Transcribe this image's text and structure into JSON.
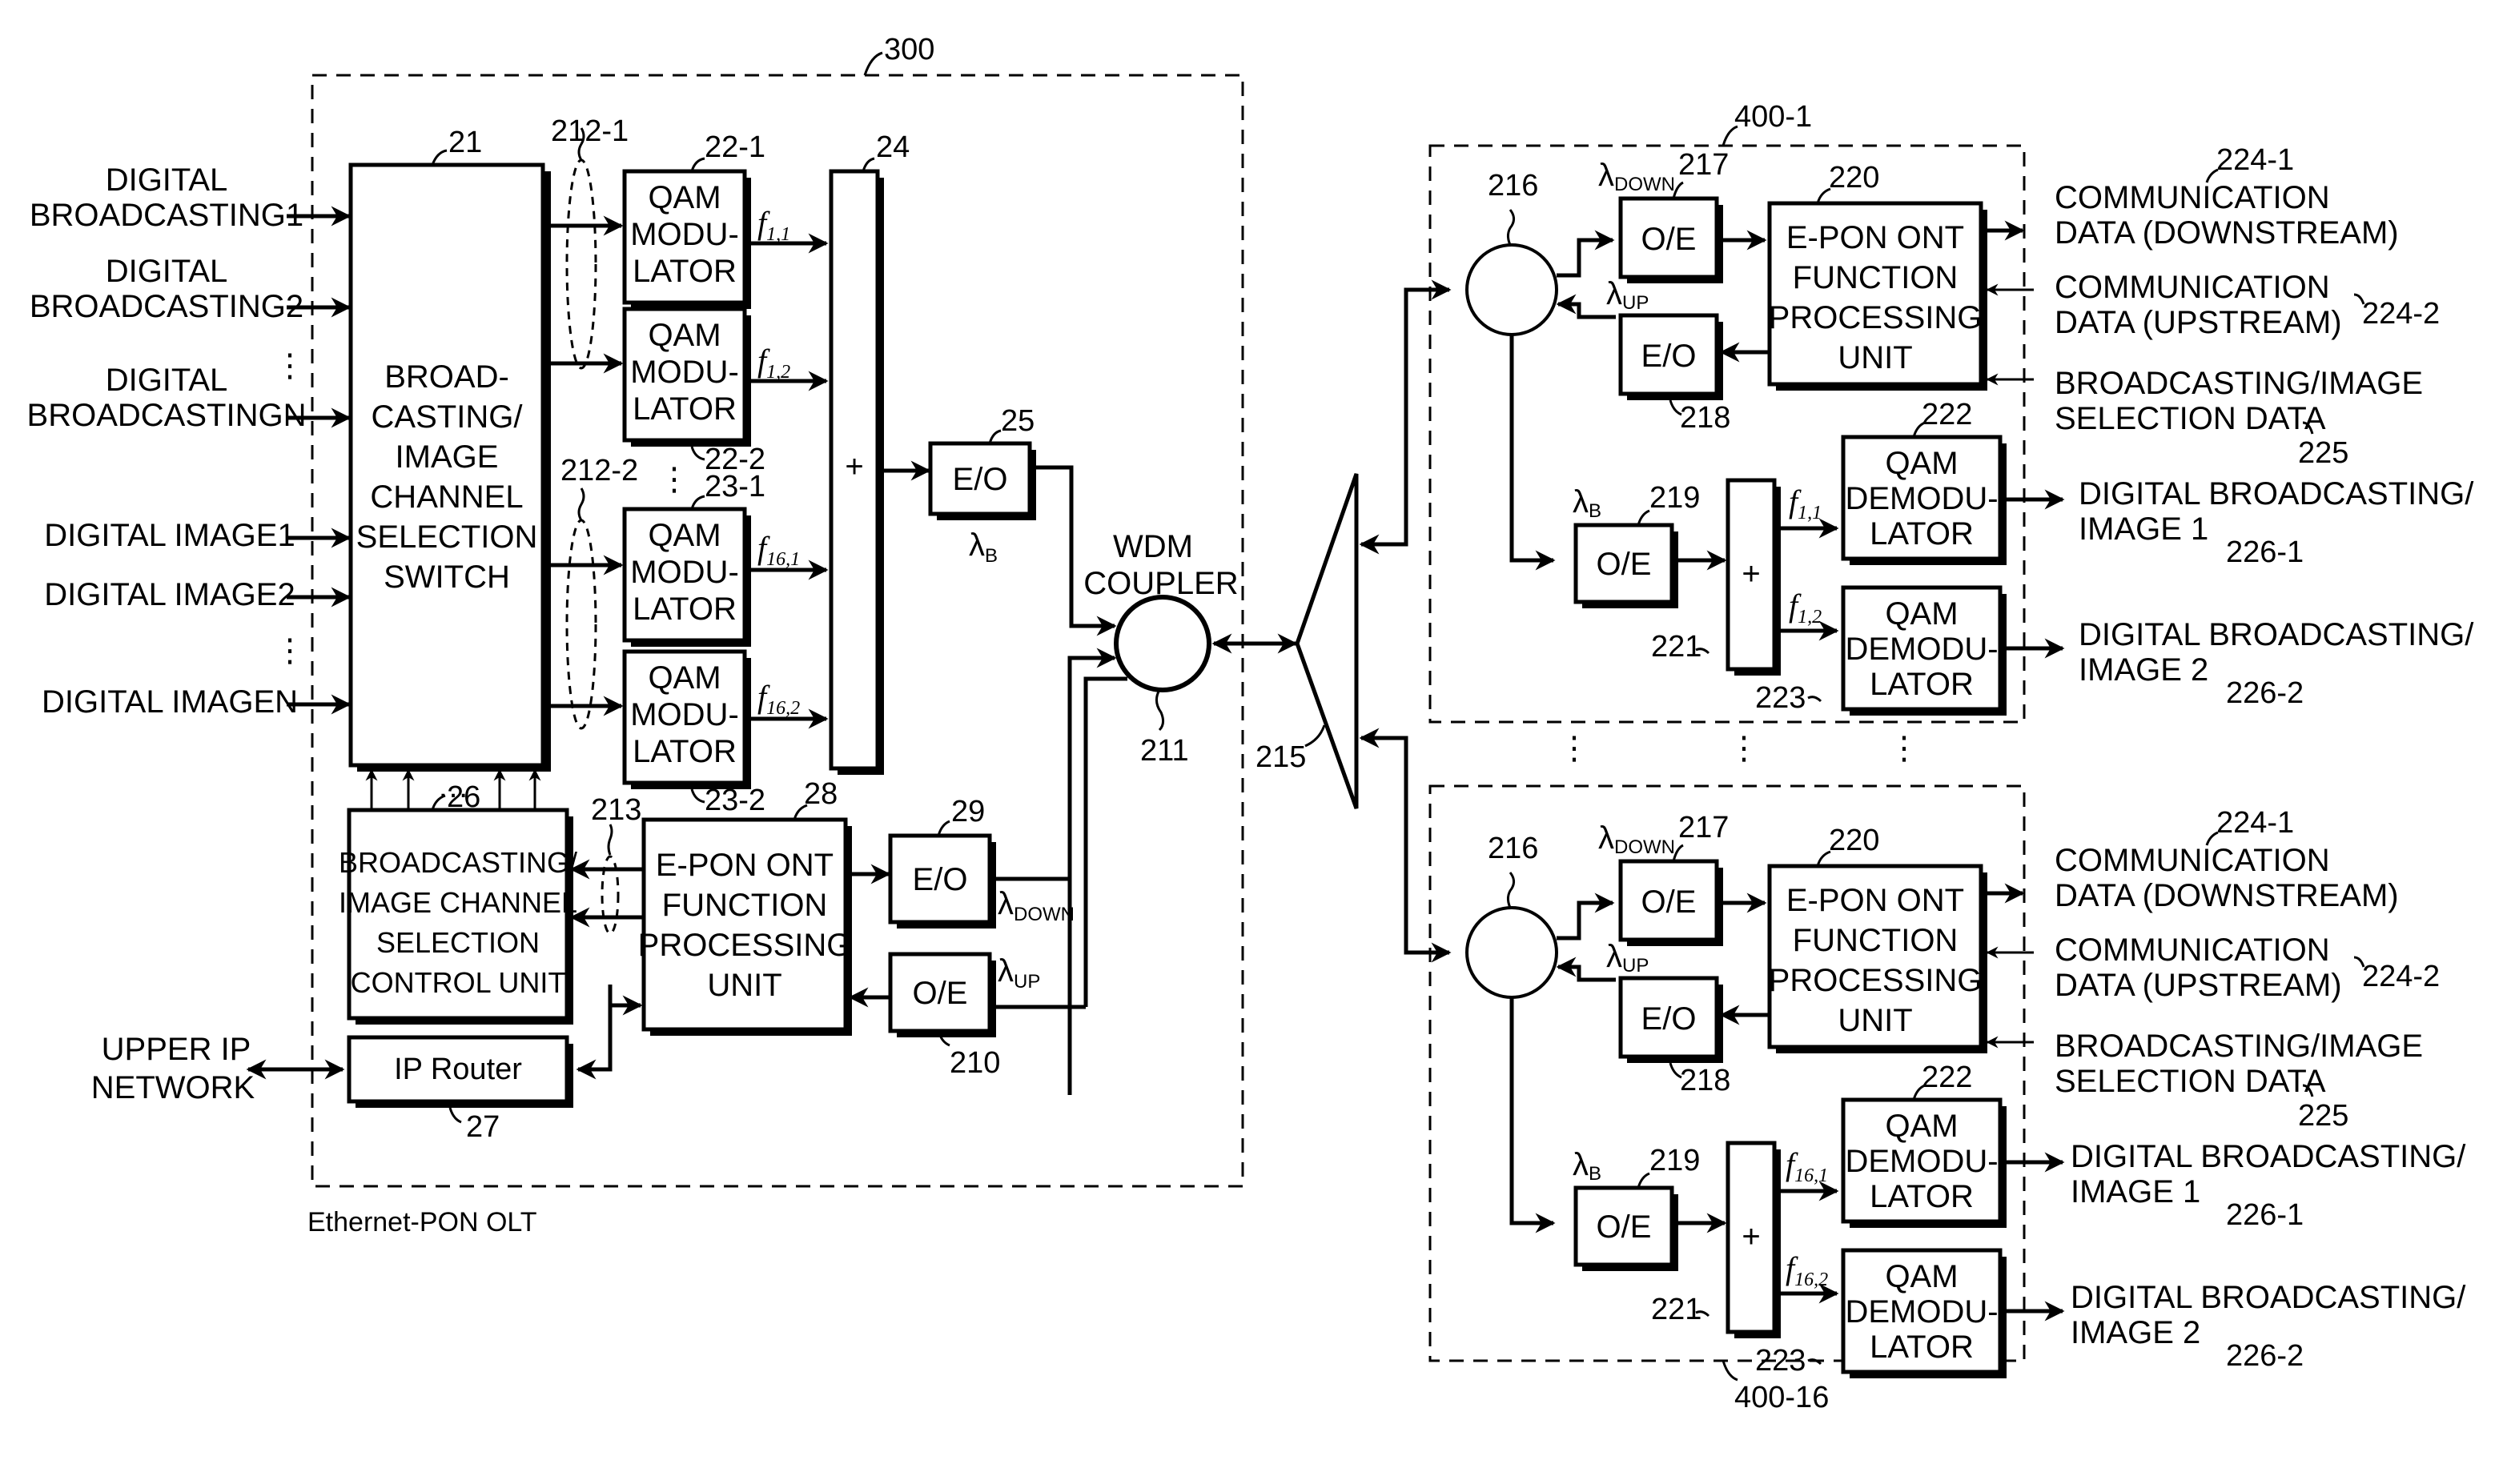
{
  "olt": {
    "ref": "300",
    "caption": "Ethernet-PON OLT",
    "inputs": [
      {
        "line1": "DIGITAL",
        "line2": "BROADCASTING1"
      },
      {
        "line1": "DIGITAL",
        "line2": "BROADCASTING2"
      },
      {
        "line1": "DIGITAL",
        "line2": "BROADCASTINGN"
      },
      {
        "line1": "",
        "line2": "DIGITAL IMAGE1"
      },
      {
        "line1": "",
        "line2": "DIGITAL IMAGE2"
      },
      {
        "line1": "",
        "line2": "DIGITAL IMAGEN"
      }
    ],
    "switch": {
      "ref": "21",
      "lines": [
        "BROAD-",
        "CASTING/",
        "IMAGE",
        "CHANNEL",
        "SELECTION",
        "SWITCH"
      ]
    },
    "bundles": {
      "first": "212-1",
      "second": "212-2",
      "control": "213"
    },
    "modulators": [
      {
        "ref": "22-1",
        "lines": [
          "QAM",
          "MODU-",
          "LATOR"
        ],
        "freq": "f",
        "freq_sub": "1,1"
      },
      {
        "ref": "22-2",
        "lines": [
          "QAM",
          "MODU-",
          "LATOR"
        ],
        "freq": "f",
        "freq_sub": "1,2"
      },
      {
        "ref": "23-1",
        "lines": [
          "QAM",
          "MODU-",
          "LATOR"
        ],
        "freq": "f",
        "freq_sub": "16,1"
      },
      {
        "ref": "23-2",
        "lines": [
          "QAM",
          "MODU-",
          "LATOR"
        ],
        "freq": "f",
        "freq_sub": "16,2"
      }
    ],
    "combiner": {
      "ref": "24",
      "symbol": "+"
    },
    "eo_b": {
      "ref": "25",
      "label": "E/O",
      "lambda": "λ",
      "lambda_sub": "B"
    },
    "wdm": {
      "ref": "211",
      "line1": "WDM",
      "line2": "COUPLER"
    },
    "control_unit": {
      "ref": "26",
      "lines": [
        "BROADCASTING/",
        "IMAGE CHANNEL",
        "SELECTION",
        "CONTROL UNIT"
      ]
    },
    "epon": {
      "ref": "28",
      "lines": [
        "E-PON ONT",
        "FUNCTION",
        "PROCESSING",
        "UNIT"
      ]
    },
    "eo_down": {
      "ref": "29",
      "label": "E/O",
      "lambda": "λ",
      "lambda_sub": "DOWN"
    },
    "oe_up": {
      "ref": "210",
      "label": "O/E",
      "lambda": "λ",
      "lambda_sub": "UP"
    },
    "router": {
      "ref": "27",
      "label": "IP Router"
    },
    "upper": {
      "line1": "UPPER IP",
      "line2": "NETWORK"
    },
    "dots": "⋮",
    "hdots": "…"
  },
  "splitter": {
    "ref": "215"
  },
  "onts": [
    {
      "ref": "400-1",
      "coupler_ref": "216",
      "oe_down": {
        "ref": "217",
        "label": "O/E",
        "lambda": "λ",
        "lambda_sub": "DOWN"
      },
      "eo_up": {
        "ref": "218",
        "label": "E/O",
        "lambda": "λ",
        "lambda_sub": "UP"
      },
      "epon": {
        "ref": "220",
        "lines": [
          "E-PON ONT",
          "FUNCTION",
          "PROCESSING",
          "UNIT"
        ]
      },
      "oe_b": {
        "ref": "219",
        "label": "O/E",
        "lambda": "λ",
        "lambda_sub": "B"
      },
      "splitter": {
        "ref": "221",
        "symbol": "+"
      },
      "demods": [
        {
          "ref": "222",
          "lines": [
            "QAM",
            "DEMODU-",
            "LATOR"
          ],
          "freq": "f",
          "freq_sub": "1,1",
          "out1": "DIGITAL BROADCASTING/",
          "out2": "IMAGE 1",
          "out_ref": "226-1"
        },
        {
          "ref": "223",
          "lines": [
            "QAM",
            "DEMODU-",
            "LATOR"
          ],
          "freq": "f",
          "freq_sub": "1,2",
          "out1": "DIGITAL BROADCASTING/",
          "out2": "IMAGE 2",
          "out_ref": "226-2"
        }
      ],
      "io": [
        {
          "line1": "COMMUNICATION",
          "line2": "DATA (DOWNSTREAM)",
          "ref": "224-1"
        },
        {
          "line1": "COMMUNICATION",
          "line2": "DATA (UPSTREAM)",
          "ref": "224-2"
        },
        {
          "line1": "BROADCASTING/IMAGE",
          "line2": "SELECTION DATA",
          "ref": "225"
        }
      ]
    },
    {
      "ref": "400-16",
      "coupler_ref": "216",
      "oe_down": {
        "ref": "217",
        "label": "O/E",
        "lambda": "λ",
        "lambda_sub": "DOWN"
      },
      "eo_up": {
        "ref": "218",
        "label": "E/O",
        "lambda": "λ",
        "lambda_sub": "UP"
      },
      "epon": {
        "ref": "220",
        "lines": [
          "E-PON ONT",
          "FUNCTION",
          "PROCESSING",
          "UNIT"
        ]
      },
      "oe_b": {
        "ref": "219",
        "label": "O/E",
        "lambda": "λ",
        "lambda_sub": "B"
      },
      "splitter": {
        "ref": "221",
        "symbol": "+"
      },
      "demods": [
        {
          "ref": "222",
          "lines": [
            "QAM",
            "DEMODU-",
            "LATOR"
          ],
          "freq": "f",
          "freq_sub": "16,1",
          "out1": "DIGITAL BROADCASTING/",
          "out2": "IMAGE 1",
          "out_ref": "226-1"
        },
        {
          "ref": "223",
          "lines": [
            "QAM",
            "DEMODU-",
            "LATOR"
          ],
          "freq": "f",
          "freq_sub": "16,2",
          "out1": "DIGITAL BROADCASTING/",
          "out2": "IMAGE 2",
          "out_ref": "226-2"
        }
      ],
      "io": [
        {
          "line1": "COMMUNICATION",
          "line2": "DATA (DOWNSTREAM)",
          "ref": "224-1"
        },
        {
          "line1": "COMMUNICATION",
          "line2": "DATA (UPSTREAM)",
          "ref": "224-2"
        },
        {
          "line1": "BROADCASTING/IMAGE",
          "line2": "SELECTION DATA",
          "ref": "225"
        }
      ]
    }
  ]
}
